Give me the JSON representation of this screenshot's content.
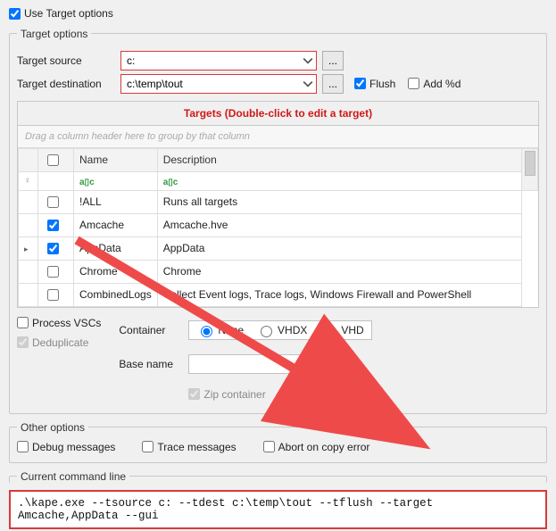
{
  "use_target_options": {
    "label": "Use Target options",
    "checked": true
  },
  "target_options": {
    "legend": "Target options",
    "source_label": "Target source",
    "source_value": "c:",
    "dest_label": "Target destination",
    "dest_value": "c:\\temp\\tout",
    "ellipsis": "...",
    "flush": {
      "label": "Flush",
      "checked": true
    },
    "add_pd": {
      "label": "Add %d",
      "checked": false
    },
    "targets_title": "Targets (Double-click to edit a target)",
    "group_hint": "Drag a column header here to group by that column",
    "columns": {
      "name": "Name",
      "description": "Description"
    },
    "filter_icon": "a▯c",
    "rows": [
      {
        "checked": false,
        "name": "!ALL",
        "description": "Runs all targets",
        "selected": false
      },
      {
        "checked": true,
        "name": "Amcache",
        "description": "Amcache.hve",
        "selected": false
      },
      {
        "checked": true,
        "name": "AppData",
        "description": "AppData",
        "selected": true,
        "handle": "▸"
      },
      {
        "checked": false,
        "name": "Chrome",
        "description": "Chrome",
        "selected": false,
        "obscured_name": true
      },
      {
        "checked": false,
        "name": "CombinedLogs",
        "description": "Collect Event logs, Trace logs, Windows Firewall and PowerShell",
        "selected": false,
        "obscured_name": true
      }
    ],
    "process_vscs": {
      "label": "Process VSCs",
      "checked": false
    },
    "deduplicate": {
      "label": "Deduplicate",
      "checked": true,
      "disabled": true
    },
    "container_label": "Container",
    "container_options": {
      "none": "None",
      "vhdx": "VHDX",
      "vhd": "VHD",
      "selected": "none"
    },
    "base_name_label": "Base name",
    "base_name_value": "",
    "zip_container": {
      "label": "Zip container",
      "checked": true,
      "disabled": true
    }
  },
  "other": {
    "legend": "Other options",
    "debug": {
      "label": "Debug messages",
      "checked": false
    },
    "trace": {
      "label": "Trace messages",
      "checked": false
    },
    "abort": {
      "label": "Abort on copy error",
      "checked": false
    }
  },
  "cmd": {
    "legend": "Current command line",
    "text": ".\\kape.exe --tsource c: --tdest c:\\temp\\tout --tflush --target Amcache,AppData --gui"
  }
}
